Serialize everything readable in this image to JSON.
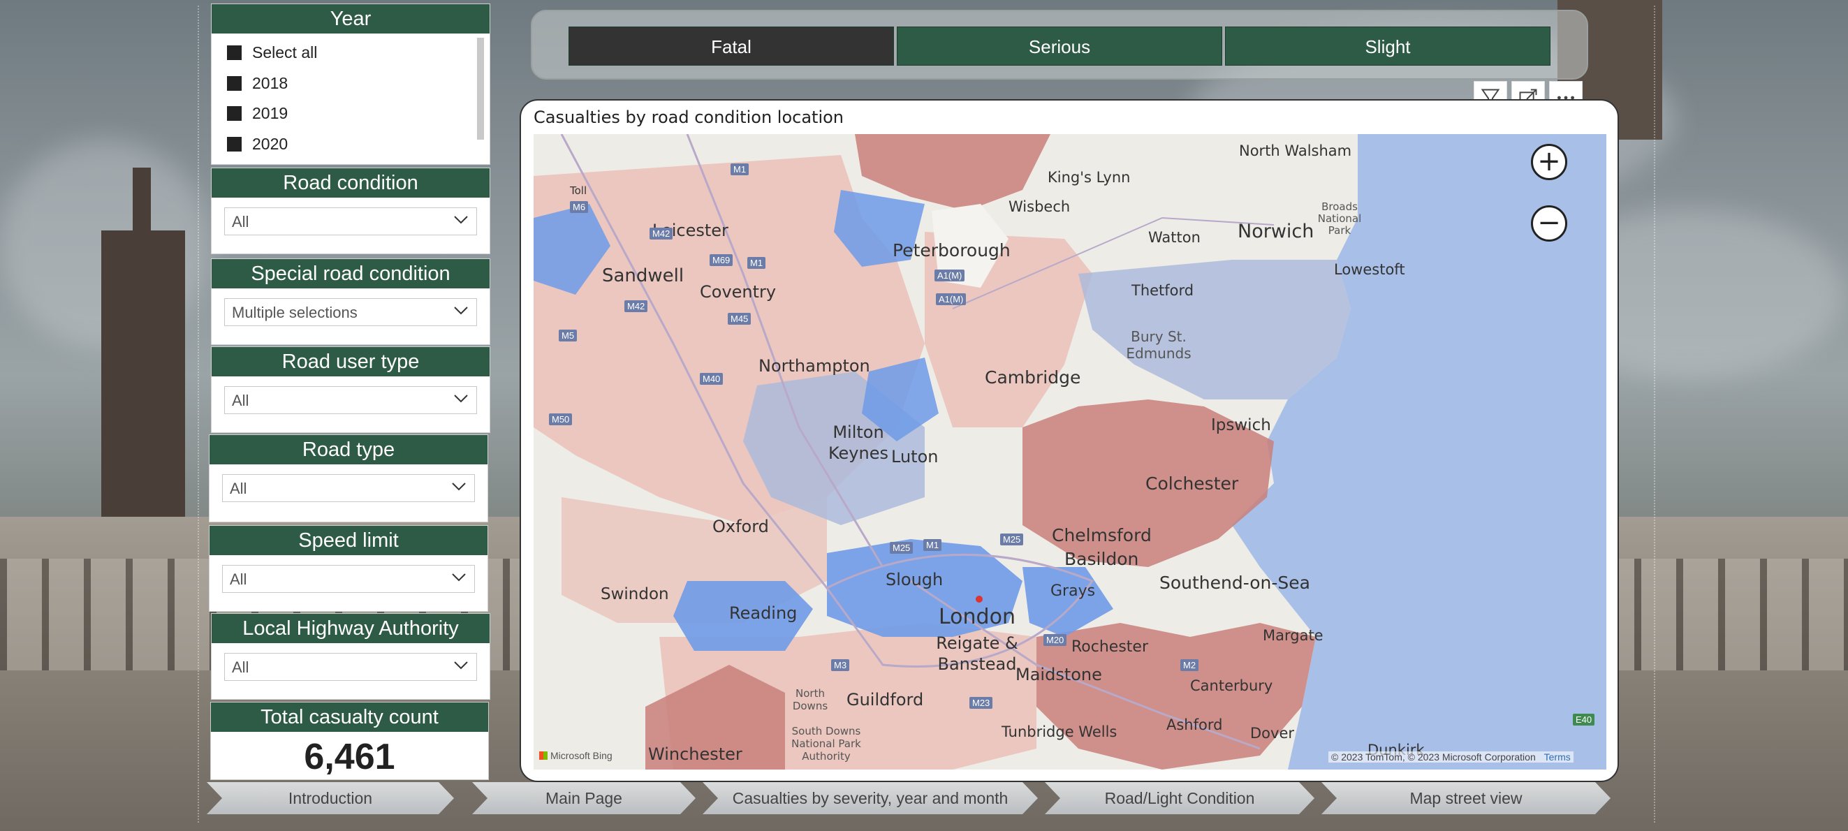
{
  "slicers": {
    "year": {
      "title": "Year",
      "options": [
        "Select all",
        "2018",
        "2019",
        "2020"
      ]
    },
    "road_condition": {
      "title": "Road condition",
      "value": "All"
    },
    "special_road_condition": {
      "title": "Special road condition",
      "value": "Multiple selections"
    },
    "road_user_type": {
      "title": "Road user type",
      "value": "All"
    },
    "road_type": {
      "title": "Road type",
      "value": "All"
    },
    "speed_limit": {
      "title": "Speed limit",
      "value": "All"
    },
    "local_highway_authority": {
      "title": "Local Highway Authority",
      "value": "All"
    }
  },
  "kpi": {
    "title": "Total casualty count",
    "value": "6,461"
  },
  "severity": {
    "buttons": [
      "Fatal",
      "Serious",
      "Slight"
    ],
    "colors": {
      "selected": "#333333",
      "default": "#2e5b46"
    }
  },
  "map": {
    "title": "Casualties by road condition location",
    "zoom_in": "+",
    "zoom_out": "−",
    "attribution": "© 2023 TomTom, © 2023 Microsoft Corporation",
    "terms": "Terms",
    "brand": "Microsoft Bing",
    "places": [
      "North Walsham",
      "King's Lynn",
      "Wisbech",
      "Leicester",
      "Toll",
      "Peterborough",
      "Watton",
      "Norwich",
      "Broads National Park",
      "Lowestoft",
      "Sandwell",
      "Coventry",
      "Thetford",
      "Bury St. Edmunds",
      "Northampton",
      "Cambridge",
      "Milton Keynes",
      "Luton",
      "Ipswich",
      "Colchester",
      "Oxford",
      "Chelmsford",
      "Basildon",
      "Southend-on-Sea",
      "Swindon",
      "Slough",
      "Grays",
      "Reading",
      "London",
      "Reigate & Banstead",
      "Rochester",
      "Margate",
      "Maidstone",
      "Canterbury",
      "Guildford",
      "North Downs",
      "South Downs National Park Authority",
      "Winchester",
      "Tunbridge Wells",
      "Ashford",
      "Dover",
      "Dunkirk"
    ],
    "highways": [
      "M1",
      "M6",
      "M42",
      "M69",
      "M1",
      "A1(M)",
      "A1(M)",
      "M5",
      "M40",
      "M45",
      "M50",
      "M25",
      "M1",
      "M25",
      "M3",
      "M20",
      "M2",
      "M23",
      "E40",
      "M42"
    ],
    "colors": {
      "high": "#c9807a",
      "mid": "#e9b8ae",
      "low": "#a9b9dc",
      "lowest": "#6f9be8",
      "sea": "#a8bfe8",
      "land": "#eeece7"
    }
  },
  "nav": [
    "Introduction",
    "Main Page",
    "Casualties by severity, year and month",
    "Road/Light Condition",
    "Map street view"
  ]
}
